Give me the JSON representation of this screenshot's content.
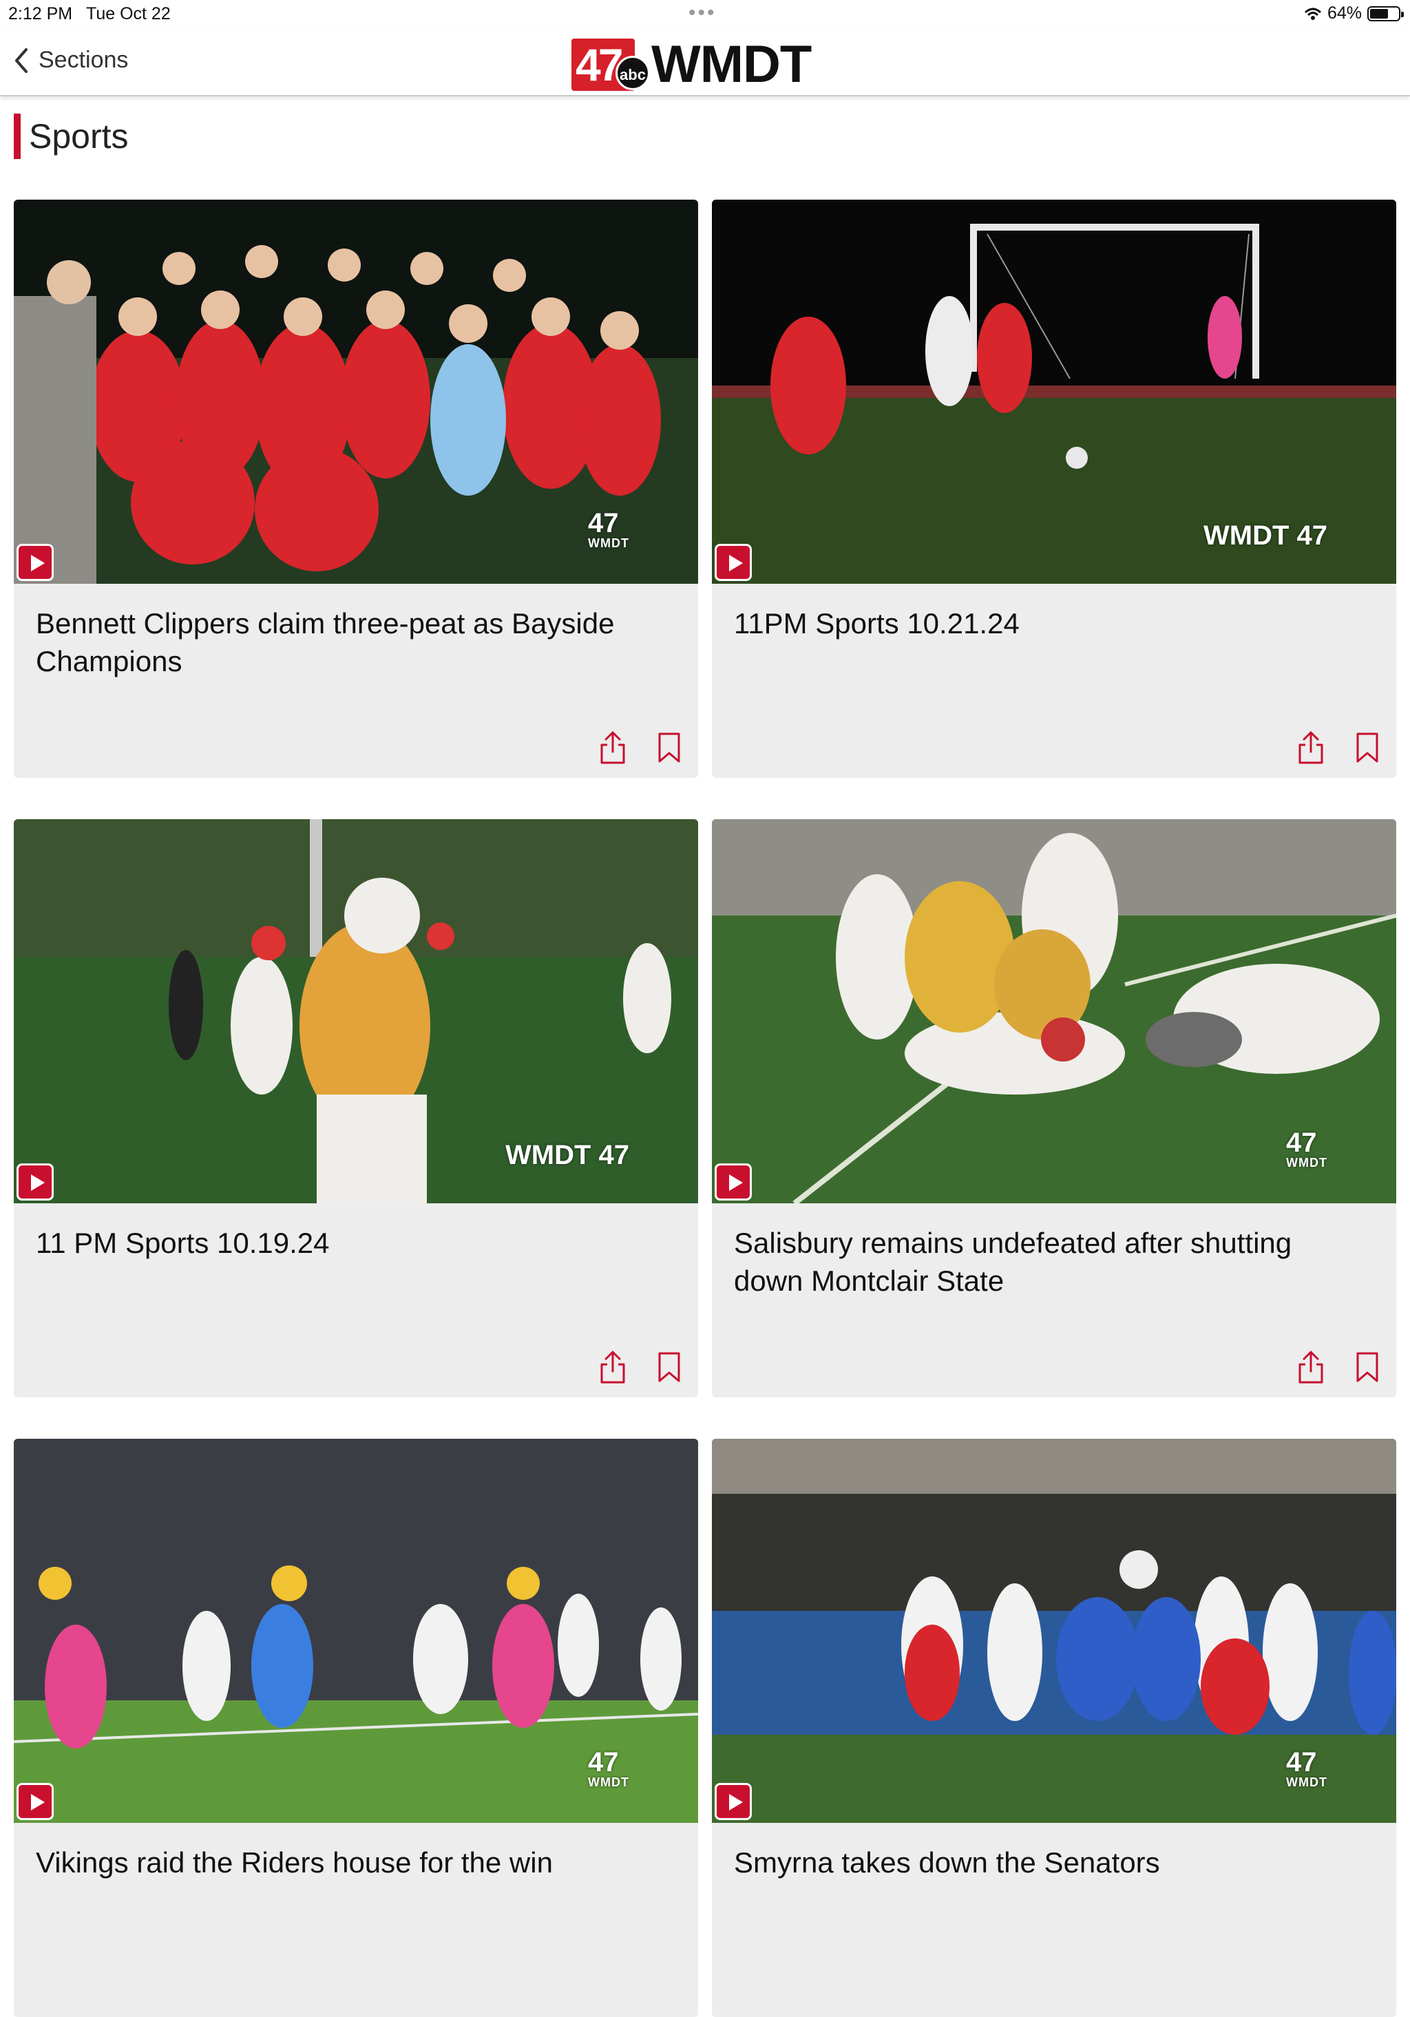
{
  "status_bar": {
    "time": "2:12 PM",
    "date": "Tue Oct 22",
    "dots": "•••",
    "battery": "64%"
  },
  "nav": {
    "back_label": "Sections",
    "logo_number": "47",
    "logo_network": "abc",
    "logo_text": "WMDT"
  },
  "section": {
    "title": "Sports"
  },
  "cards": [
    {
      "title": "Bennett Clippers claim three-peat as Bayside Champions",
      "watermark": "47",
      "watermark_sub": "WMDT"
    },
    {
      "title": "11PM Sports 10.21.24",
      "watermark": "WMDT 47",
      "watermark_sub": ""
    },
    {
      "title": "11 PM Sports 10.19.24",
      "watermark": "WMDT 47",
      "watermark_sub": ""
    },
    {
      "title": "Salisbury remains undefeated after shutting down Montclair State",
      "watermark": "47",
      "watermark_sub": "WMDT"
    },
    {
      "title": "Vikings raid the Riders house for the win",
      "watermark": "47",
      "watermark_sub": "WMDT"
    },
    {
      "title": "Smyrna takes down the Senators",
      "watermark": "47",
      "watermark_sub": "WMDT"
    }
  ],
  "colors": {
    "accent": "#c8102e",
    "card_bg": "#ededed"
  },
  "icons": {
    "back": "chevron-left-icon",
    "share": "share-icon",
    "bookmark": "bookmark-icon",
    "play": "play-icon"
  }
}
